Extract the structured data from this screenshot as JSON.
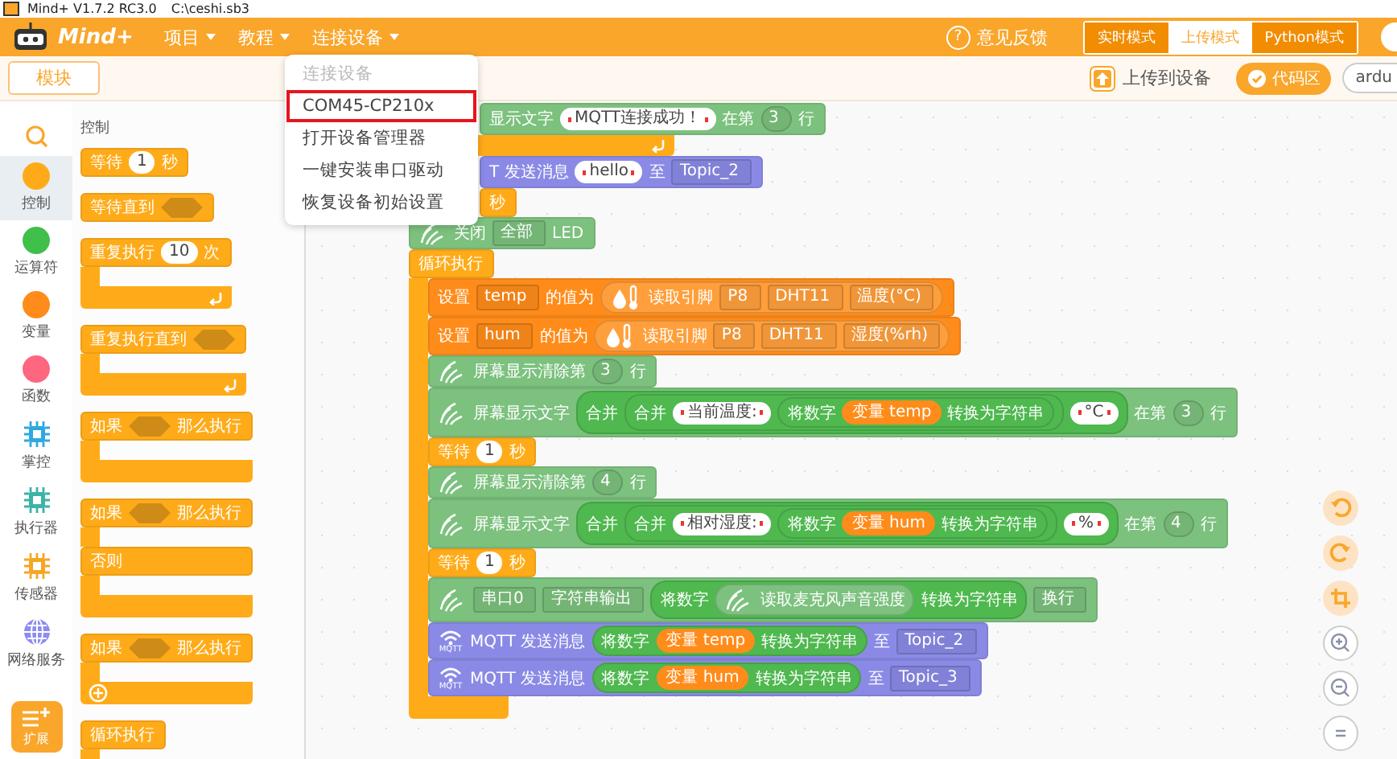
{
  "title_bar": {
    "title": "Mind+ V1.7.2 RC3.0",
    "file": "C:\\ceshi.sb3"
  },
  "menu_bar": {
    "logo": "Mind+",
    "menus": [
      {
        "label": "项目"
      },
      {
        "label": "教程"
      },
      {
        "label": "连接设备"
      }
    ],
    "feedback_icon": "?",
    "feedback": "意见反馈",
    "modes": [
      {
        "label": "实时模式",
        "selected": false
      },
      {
        "label": "上传模式",
        "selected": true
      },
      {
        "label": "Python模式",
        "selected": false
      }
    ]
  },
  "toolbar": {
    "tab": "模块",
    "upload": "上传到设备",
    "code_area": "代码区",
    "board": "ardu"
  },
  "device_menu": {
    "items": [
      {
        "label": "连接设备",
        "disabled": true,
        "selected": false
      },
      {
        "label": "COM45-CP210x",
        "disabled": false,
        "selected": true
      },
      {
        "label": "打开设备管理器",
        "disabled": false,
        "selected": false
      },
      {
        "label": "一键安装串口驱动",
        "disabled": false,
        "selected": false
      },
      {
        "label": "恢复设备初始设置",
        "disabled": false,
        "selected": false
      }
    ]
  },
  "categories": [
    {
      "label": "控制",
      "kind": "dot",
      "color": "#ffab19",
      "selected": true
    },
    {
      "label": "运算符",
      "kind": "dot",
      "color": "#40bf4a",
      "selected": false
    },
    {
      "label": "变量",
      "kind": "dot",
      "color": "#ff8c1a",
      "selected": false
    },
    {
      "label": "函数",
      "kind": "dot",
      "color": "#ff6680",
      "selected": false
    },
    {
      "label": "掌控",
      "kind": "chip",
      "color": "#2fa8e0",
      "selected": false
    },
    {
      "label": "执行器",
      "kind": "chip",
      "color": "#3bb3a6",
      "selected": false
    },
    {
      "label": "传感器",
      "kind": "chip",
      "color": "#f5a623",
      "selected": false
    },
    {
      "label": "网络服务",
      "kind": "globe",
      "color": "#8d8df0",
      "selected": false
    }
  ],
  "extension": "扩展",
  "palette": {
    "heading": "控制",
    "blocks": [
      {
        "kind": "block",
        "color": "#ffab19",
        "segments": [
          {
            "kind": "text",
            "text": "等待"
          },
          {
            "kind": "num",
            "text": "1"
          },
          {
            "kind": "text",
            "text": "秒"
          }
        ]
      },
      {
        "kind": "block",
        "color": "#ffab19",
        "segments": [
          {
            "kind": "text",
            "text": "等待直到"
          },
          {
            "kind": "hex"
          }
        ]
      },
      {
        "kind": "c",
        "color": "#ffab19",
        "loop": true,
        "arms": [
          {
            "segments": [
              {
                "kind": "text",
                "text": "重复执行"
              },
              {
                "kind": "num",
                "text": "10"
              },
              {
                "kind": "text",
                "text": "次"
              }
            ]
          }
        ]
      },
      {
        "kind": "c",
        "color": "#ffab19",
        "loop": true,
        "arms": [
          {
            "segments": [
              {
                "kind": "text",
                "text": "重复执行直到"
              },
              {
                "kind": "hex"
              }
            ]
          }
        ]
      },
      {
        "kind": "c",
        "color": "#ffab19",
        "arms": [
          {
            "segments": [
              {
                "kind": "text",
                "text": "如果"
              },
              {
                "kind": "hex"
              },
              {
                "kind": "text",
                "text": "那么执行"
              }
            ]
          }
        ]
      },
      {
        "kind": "c",
        "color": "#ffab19",
        "arms": [
          {
            "segments": [
              {
                "kind": "text",
                "text": "如果"
              },
              {
                "kind": "hex"
              },
              {
                "kind": "text",
                "text": "那么执行"
              }
            ]
          },
          {
            "segments": [
              {
                "kind": "text",
                "text": "否则"
              }
            ]
          }
        ]
      },
      {
        "kind": "c",
        "color": "#ffab19",
        "plus": true,
        "arms": [
          {
            "segments": [
              {
                "kind": "text",
                "text": "如果"
              },
              {
                "kind": "hex"
              },
              {
                "kind": "text",
                "text": "那么执行"
              }
            ]
          }
        ]
      },
      {
        "kind": "c",
        "color": "#ffab19",
        "arms": [
          {
            "segments": [
              {
                "kind": "text",
                "text": "循环执行"
              }
            ]
          }
        ]
      }
    ]
  },
  "script": [
    {
      "kind": "block",
      "color": "#7cc17e",
      "covered": true,
      "segments": [
        {
          "kind": "text",
          "text": "显示文字"
        },
        {
          "kind": "str",
          "text": "MQTT连接成功！"
        },
        {
          "kind": "text",
          "text": "在第"
        },
        {
          "kind": "dd",
          "round": true,
          "text": "3"
        },
        {
          "kind": "text",
          "text": "行"
        }
      ]
    },
    {
      "kind": "c_end",
      "color": "#ffab19",
      "loop": true
    },
    {
      "kind": "block",
      "color": "#8a8ae6",
      "covered": true,
      "segments": [
        {
          "kind": "text",
          "text": "T 发送消息"
        },
        {
          "kind": "str",
          "text": "hello"
        },
        {
          "kind": "text",
          "text": "至"
        },
        {
          "kind": "dd",
          "round": false,
          "text": "Topic_2"
        }
      ]
    },
    {
      "kind": "block",
      "color": "#ffab19",
      "covered": true,
      "segments": [
        {
          "kind": "text",
          "text": "秒"
        }
      ]
    },
    {
      "kind": "block",
      "color": "#7cc17e",
      "segments": [
        {
          "kind": "hand"
        },
        {
          "kind": "text",
          "text": "关闭"
        },
        {
          "kind": "dd",
          "round": false,
          "text": "全部"
        },
        {
          "kind": "text",
          "text": "LED"
        }
      ]
    },
    {
      "kind": "c",
      "color": "#ffab19",
      "arms": [
        {
          "segments": [
            {
              "kind": "text",
              "text": "循环执行"
            }
          ],
          "children": [
            {
              "kind": "block",
              "color": "#ff8c1a",
              "segments": [
                {
                  "kind": "text",
                  "text": "设置"
                },
                {
                  "kind": "dd",
                  "round": false,
                  "text": "temp"
                },
                {
                  "kind": "text",
                  "text": "的值为"
                },
                {
                  "kind": "rep",
                  "color": "#ff9f3c",
                  "segments": [
                    {
                      "kind": "dht"
                    },
                    {
                      "kind": "text",
                      "text": "读取引脚"
                    },
                    {
                      "kind": "dd",
                      "round": false,
                      "text": "P8"
                    },
                    {
                      "kind": "dd",
                      "round": false,
                      "text": "DHT11"
                    },
                    {
                      "kind": "dd",
                      "round": false,
                      "text": "温度(°C)"
                    }
                  ]
                }
              ]
            },
            {
              "kind": "block",
              "color": "#ff8c1a",
              "segments": [
                {
                  "kind": "text",
                  "text": "设置"
                },
                {
                  "kind": "dd",
                  "round": false,
                  "text": "hum"
                },
                {
                  "kind": "text",
                  "text": "的值为"
                },
                {
                  "kind": "rep",
                  "color": "#ff9f3c",
                  "segments": [
                    {
                      "kind": "dht"
                    },
                    {
                      "kind": "text",
                      "text": "读取引脚"
                    },
                    {
                      "kind": "dd",
                      "round": false,
                      "text": "P8"
                    },
                    {
                      "kind": "dd",
                      "round": false,
                      "text": "DHT11"
                    },
                    {
                      "kind": "dd",
                      "round": false,
                      "text": "湿度(%rh)"
                    }
                  ]
                }
              ]
            },
            {
              "kind": "block",
              "color": "#7cc17e",
              "segments": [
                {
                  "kind": "hand"
                },
                {
                  "kind": "text",
                  "text": "屏幕显示清除第"
                },
                {
                  "kind": "dd",
                  "round": true,
                  "text": "3"
                },
                {
                  "kind": "text",
                  "text": "行"
                }
              ]
            },
            {
              "kind": "block",
              "color": "#7cc17e",
              "segments": [
                {
                  "kind": "hand"
                },
                {
                  "kind": "text",
                  "text": "屏幕显示文字"
                },
                {
                  "kind": "rep",
                  "color": "#4fb84f",
                  "segments": [
                    {
                      "kind": "text",
                      "text": "合并"
                    },
                    {
                      "kind": "rep",
                      "color": "#4fb84f",
                      "segments": [
                        {
                          "kind": "text",
                          "text": "合并"
                        },
                        {
                          "kind": "str",
                          "text": "当前温度:"
                        },
                        {
                          "kind": "rep",
                          "color": "#4fb84f",
                          "segments": [
                            {
                              "kind": "text",
                              "text": "将数字"
                            },
                            {
                              "kind": "var",
                              "text": "变量 temp"
                            },
                            {
                              "kind": "text",
                              "text": "转换为字符串"
                            }
                          ]
                        }
                      ]
                    },
                    {
                      "kind": "str",
                      "text": "°C"
                    }
                  ]
                },
                {
                  "kind": "text",
                  "text": "在第"
                },
                {
                  "kind": "dd",
                  "round": true,
                  "text": "3"
                },
                {
                  "kind": "text",
                  "text": "行"
                }
              ]
            },
            {
              "kind": "block",
              "color": "#ffab19",
              "segments": [
                {
                  "kind": "text",
                  "text": "等待"
                },
                {
                  "kind": "num",
                  "text": "1"
                },
                {
                  "kind": "text",
                  "text": "秒"
                }
              ]
            },
            {
              "kind": "block",
              "color": "#7cc17e",
              "segments": [
                {
                  "kind": "hand"
                },
                {
                  "kind": "text",
                  "text": "屏幕显示清除第"
                },
                {
                  "kind": "dd",
                  "round": true,
                  "text": "4"
                },
                {
                  "kind": "text",
                  "text": "行"
                }
              ]
            },
            {
              "kind": "block",
              "color": "#7cc17e",
              "segments": [
                {
                  "kind": "hand"
                },
                {
                  "kind": "text",
                  "text": "屏幕显示文字"
                },
                {
                  "kind": "rep",
                  "color": "#4fb84f",
                  "segments": [
                    {
                      "kind": "text",
                      "text": "合并"
                    },
                    {
                      "kind": "rep",
                      "color": "#4fb84f",
                      "segments": [
                        {
                          "kind": "text",
                          "text": "合并"
                        },
                        {
                          "kind": "str",
                          "text": "相对湿度:"
                        },
                        {
                          "kind": "rep",
                          "color": "#4fb84f",
                          "segments": [
                            {
                              "kind": "text",
                              "text": "将数字"
                            },
                            {
                              "kind": "var",
                              "text": "变量 hum"
                            },
                            {
                              "kind": "text",
                              "text": "转换为字符串"
                            }
                          ]
                        }
                      ]
                    },
                    {
                      "kind": "str",
                      "text": "%"
                    }
                  ]
                },
                {
                  "kind": "text",
                  "text": "在第"
                },
                {
                  "kind": "dd",
                  "round": true,
                  "text": "4"
                },
                {
                  "kind": "text",
                  "text": "行"
                }
              ]
            },
            {
              "kind": "block",
              "color": "#ffab19",
              "segments": [
                {
                  "kind": "text",
                  "text": "等待"
                },
                {
                  "kind": "num",
                  "text": "1"
                },
                {
                  "kind": "text",
                  "text": "秒"
                }
              ]
            },
            {
              "kind": "block",
              "color": "#7cc17e",
              "segments": [
                {
                  "kind": "hand"
                },
                {
                  "kind": "dd",
                  "round": false,
                  "text": "串口0"
                },
                {
                  "kind": "dd",
                  "round": false,
                  "text": "字符串输出"
                },
                {
                  "kind": "rep",
                  "color": "#4fb84f",
                  "segments": [
                    {
                      "kind": "text",
                      "text": "将数字"
                    },
                    {
                      "kind": "rep",
                      "color": "#7cc17e",
                      "segments": [
                        {
                          "kind": "hand"
                        },
                        {
                          "kind": "text",
                          "text": "读取麦克风声音强度"
                        }
                      ]
                    },
                    {
                      "kind": "text",
                      "text": "转换为字符串"
                    }
                  ]
                },
                {
                  "kind": "dd",
                  "round": false,
                  "text": "换行"
                }
              ]
            },
            {
              "kind": "block",
              "color": "#8a8ae6",
              "segments": [
                {
                  "kind": "mqtt",
                  "label": "MQTT"
                },
                {
                  "kind": "text",
                  "text": "MQTT 发送消息"
                },
                {
                  "kind": "rep",
                  "color": "#4fb84f",
                  "segments": [
                    {
                      "kind": "text",
                      "text": "将数字"
                    },
                    {
                      "kind": "var",
                      "text": "变量 temp"
                    },
                    {
                      "kind": "text",
                      "text": "转换为字符串"
                    }
                  ]
                },
                {
                  "kind": "text",
                  "text": "至"
                },
                {
                  "kind": "dd",
                  "round": false,
                  "text": "Topic_2"
                }
              ]
            },
            {
              "kind": "block",
              "color": "#8a8ae6",
              "segments": [
                {
                  "kind": "mqtt",
                  "label": "MQTT"
                },
                {
                  "kind": "text",
                  "text": "MQTT 发送消息"
                },
                {
                  "kind": "rep",
                  "color": "#4fb84f",
                  "segments": [
                    {
                      "kind": "text",
                      "text": "将数字"
                    },
                    {
                      "kind": "var",
                      "text": "变量 hum"
                    },
                    {
                      "kind": "text",
                      "text": "转换为字符串"
                    }
                  ]
                },
                {
                  "kind": "text",
                  "text": "至"
                },
                {
                  "kind": "dd",
                  "round": false,
                  "text": "Topic_3"
                }
              ]
            }
          ]
        }
      ]
    }
  ]
}
